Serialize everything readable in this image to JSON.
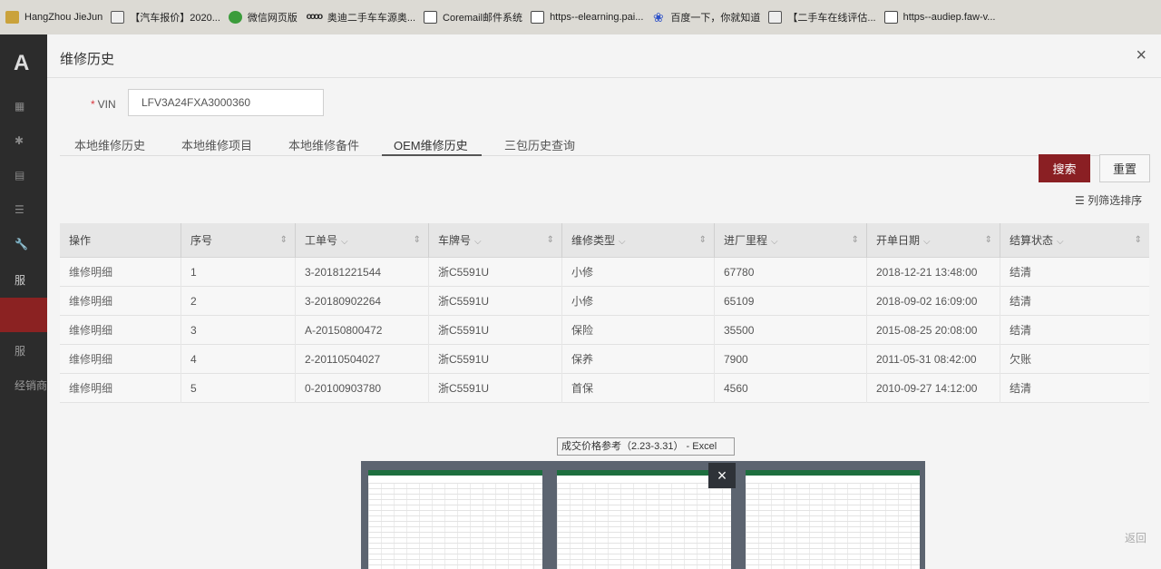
{
  "bookmarks": [
    {
      "label": "HangZhou JieJun",
      "icon": "folder-icon"
    },
    {
      "label": "【汽车报价】2020...",
      "icon": "site-icon"
    },
    {
      "label": "微信网页版",
      "icon": "wechat-icon"
    },
    {
      "label": "奥迪二手车车源奥...",
      "icon": "audi-icon"
    },
    {
      "label": "Coremail邮件系统",
      "icon": "page-icon"
    },
    {
      "label": "https--elearning.pai...",
      "icon": "page-icon"
    },
    {
      "label": "百度一下，你就知道",
      "icon": "baidu-icon"
    },
    {
      "label": "【二手车在线评估...",
      "icon": "site-icon"
    },
    {
      "label": "https--audiep.faw-v...",
      "icon": "page-icon"
    }
  ],
  "sidebar": {
    "logo": "A",
    "texts": [
      "服",
      "服",
      "经销商"
    ]
  },
  "modal": {
    "title": "维修历史",
    "close": "×"
  },
  "vin": {
    "required_mark": "*",
    "label": "VIN",
    "value": "LFV3A24FXA3000360"
  },
  "tabs": [
    {
      "label": "本地维修历史",
      "active": false
    },
    {
      "label": "本地维修项目",
      "active": false
    },
    {
      "label": "本地维修备件",
      "active": false
    },
    {
      "label": "OEM维修历史",
      "active": true
    },
    {
      "label": "三包历史查询",
      "active": false
    }
  ],
  "buttons": {
    "search": "搜索",
    "reset": "重置",
    "column_filter": "☰ 列筛选排序"
  },
  "table": {
    "columns": [
      "操作",
      "序号",
      "工单号",
      "车牌号",
      "维修类型",
      "进厂里程",
      "开单日期",
      "结算状态"
    ],
    "rows": [
      [
        "维修明细",
        "1",
        "3-20181221544",
        "浙C5591U",
        "小修",
        "67780",
        "2018-12-21 13:48:00",
        "结清"
      ],
      [
        "维修明细",
        "2",
        "3-20180902264",
        "浙C5591U",
        "小修",
        "65109",
        "2018-09-02 16:09:00",
        "结清"
      ],
      [
        "维修明细",
        "3",
        "A-20150800472",
        "浙C5591U",
        "保险",
        "35500",
        "2015-08-25 20:08:00",
        "结清"
      ],
      [
        "维修明细",
        "4",
        "2-20110504027",
        "浙C5591U",
        "保养",
        "7900",
        "2011-05-31 08:42:00",
        "欠账"
      ],
      [
        "维修明细",
        "5",
        "0-20100903780",
        "浙C5591U",
        "首保",
        "4560",
        "2010-09-27 14:12:00",
        "结清"
      ]
    ]
  },
  "return_label": "返回",
  "taskbar_preview": {
    "tooltip": "成交价格参考（2.23-3.31） - Excel",
    "close": "×"
  }
}
